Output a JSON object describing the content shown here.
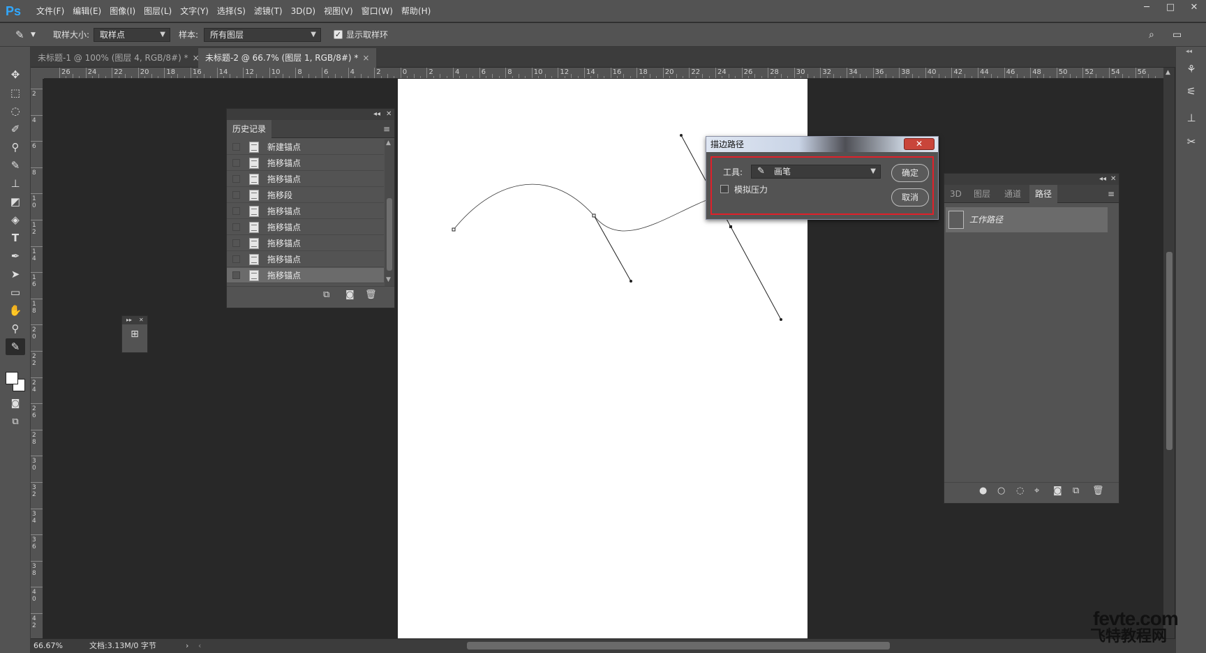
{
  "app": {
    "logo": "Ps"
  },
  "menu": [
    "文件(F)",
    "编辑(E)",
    "图像(I)",
    "图层(L)",
    "文字(Y)",
    "选择(S)",
    "滤镜(T)",
    "3D(D)",
    "视图(V)",
    "窗口(W)",
    "帮助(H)"
  ],
  "window_controls": {
    "minimize": "─",
    "maximize": "□",
    "close": "✕"
  },
  "options": {
    "sample_size_label": "取样大小:",
    "sample_size_value": "取样点",
    "sample_label": "样本:",
    "sample_value": "所有图层",
    "show_ring_label": "显示取样环",
    "show_ring_checked": true
  },
  "tabs": [
    {
      "label": "未标题-1 @ 100% (图层 4, RGB/8#) *",
      "close": "×"
    },
    {
      "label": "未标题-2 @ 66.7% (图层 1, RGB/8#) *",
      "close": "×"
    }
  ],
  "ruler_top_labels": [
    "26",
    "24",
    "22",
    "20",
    "18",
    "16",
    "14",
    "12",
    "10",
    "8",
    "6",
    "4",
    "2",
    "0",
    "2",
    "4",
    "6",
    "8",
    "10",
    "12",
    "14",
    "16",
    "18",
    "20",
    "22",
    "24",
    "26",
    "28",
    "30",
    "32",
    "34",
    "36",
    "38",
    "40",
    "42",
    "44",
    "46",
    "48",
    "50",
    "52",
    "54",
    "56"
  ],
  "ruler_left_labels": [
    "2",
    "4",
    "6",
    "8",
    "1 0",
    "1 2",
    "1 4",
    "1 6",
    "1 8",
    "2 0",
    "2 2",
    "2 4",
    "2 6",
    "2 8",
    "3 0",
    "3 2",
    "3 4",
    "3 6",
    "3 8",
    "4 0",
    "4 2"
  ],
  "history_panel": {
    "title": "历史记录",
    "items": [
      "新建锚点",
      "拖移锚点",
      "拖移锚点",
      "拖移段",
      "拖移锚点",
      "拖移锚点",
      "拖移锚点",
      "拖移锚点",
      "拖移锚点"
    ],
    "selected_index": 8
  },
  "paths_panel": {
    "tabs": [
      "3D",
      "图层",
      "通道",
      "路径"
    ],
    "active_tab": "路径",
    "work_path_label": "工作路径"
  },
  "stroke_dialog": {
    "title": "描边路径",
    "tool_label": "工具:",
    "tool_value": "画笔",
    "simulate_pressure_label": "模拟压力",
    "ok_label": "确定",
    "cancel_label": "取消"
  },
  "status": {
    "zoom": "66.67%",
    "doc_info": "文档:3.13M/0 字节"
  },
  "watermark": {
    "top": "fevte.com",
    "bottom": "飞特教程网"
  },
  "colors": {
    "accent": "#31a8ff",
    "dialog_highlight": "#e0202a",
    "panel_bg": "#535353",
    "canvas_bg": "#282828"
  },
  "icons": {
    "tools": [
      "move-icon",
      "marquee-icon",
      "lasso-icon",
      "quick-select-icon",
      "eyedropper-icon",
      "brush-icon",
      "stamp-icon",
      "eraser-icon",
      "paint-bucket-icon",
      "type-icon",
      "pen-icon",
      "path-select-icon",
      "rectangle-icon",
      "hand-icon",
      "zoom-icon",
      "eyedropper-active-icon"
    ]
  }
}
